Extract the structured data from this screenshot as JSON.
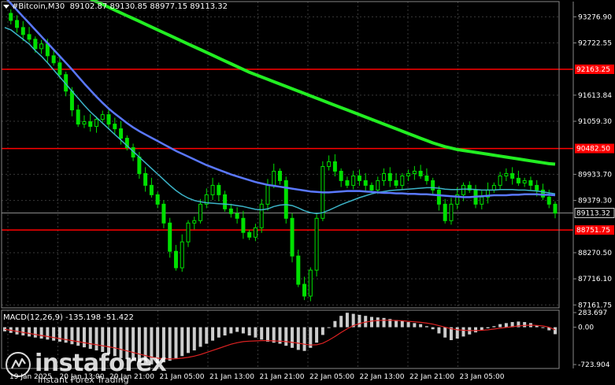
{
  "header": {
    "symbol": "#Bitcoin,M30",
    "ohlc": "89102.87 89130.85 88977.15 89113.32"
  },
  "macd": {
    "label": "MACD(12,26,9) -135.198 -51.422"
  },
  "watermark": {
    "brand": "instaforex",
    "tagline": "Instant Forex Trading"
  },
  "colors": {
    "bg": "#000000",
    "candle": "#00e000",
    "grid": "#3a3a3a",
    "level": "#ff0000",
    "ma_fast": "#3cb4c8",
    "ma_mid": "#5a78ff",
    "ma_slow": "#22ee22",
    "signal": "#dd2222",
    "hist": "#cccccc"
  },
  "chart_data": {
    "type": "candlestick",
    "symbol": "#Bitcoin",
    "timeframe": "M30",
    "price_axis": {
      "ticks": [
        93276.9,
        92722.55,
        91613.84,
        91059.3,
        89933.7,
        89379.3,
        88270.5,
        87716.1,
        87161.75
      ],
      "range": [
        87100,
        93600
      ]
    },
    "time_axis": {
      "ticks": [
        "19 Jan 2025",
        "20 Jan 13:00",
        "20 Jan 21:00",
        "21 Jan 05:00",
        "21 Jan 13:00",
        "21 Jan 21:00",
        "22 Jan 05:00",
        "22 Jan 13:00",
        "22 Jan 21:00",
        "23 Jan 05:00"
      ]
    },
    "levels": [
      {
        "price": 92163.25,
        "label": "92163.25",
        "color": "#ff0000"
      },
      {
        "price": 90482.5,
        "label": "90482.50",
        "color": "#ff0000"
      },
      {
        "price": 88751.75,
        "label": "88751.75",
        "color": "#ff0000"
      }
    ],
    "current_price": {
      "price": 89113.32,
      "label": "89113.32"
    },
    "close_series": [
      93350,
      93200,
      93050,
      92900,
      92800,
      92600,
      92700,
      92450,
      92300,
      92050,
      91700,
      91300,
      91000,
      91050,
      90950,
      91100,
      91200,
      91000,
      90900,
      90700,
      90500,
      90300,
      89950,
      89700,
      89500,
      89300,
      88900,
      88300,
      87950,
      88500,
      88900,
      88950,
      89300,
      89500,
      89700,
      89500,
      89200,
      89100,
      89000,
      88700,
      88600,
      88800,
      89300,
      89700,
      90000,
      89800,
      89000,
      88200,
      87600,
      87350,
      87900,
      89000,
      90100,
      90200,
      90000,
      89800,
      89700,
      89900,
      89800,
      89700,
      89600,
      89800,
      89950,
      89800,
      89700,
      89900,
      89950,
      90000,
      89900,
      89800,
      89600,
      89300,
      88950,
      89300,
      89500,
      89700,
      89600,
      89300,
      89450,
      89600,
      89700,
      89900,
      89950,
      89850,
      89750,
      89800,
      89700,
      89600,
      89450,
      89300,
      89110
    ],
    "moving_averages": [
      {
        "name": "MA fast",
        "color": "#3cb4c8",
        "values": [
          93050,
          93000,
          92900,
          92800,
          92700,
          92560,
          92440,
          92300,
          92150,
          92000,
          91850,
          91700,
          91550,
          91400,
          91260,
          91140,
          91020,
          90900,
          90780,
          90660,
          90540,
          90420,
          90300,
          90180,
          90060,
          89940,
          89820,
          89700,
          89590,
          89500,
          89430,
          89380,
          89350,
          89330,
          89320,
          89310,
          89300,
          89290,
          89270,
          89250,
          89220,
          89190,
          89180,
          89200,
          89250,
          89280,
          89290,
          89270,
          89220,
          89160,
          89120,
          89100,
          89120,
          89170,
          89230,
          89290,
          89340,
          89390,
          89440,
          89480,
          89520,
          89550,
          89570,
          89590,
          89600,
          89610,
          89620,
          89630,
          89640,
          89650,
          89650,
          89640,
          89620,
          89610,
          89610,
          89620,
          89620,
          89610,
          89600,
          89600,
          89600,
          89610,
          89610,
          89610,
          89600,
          89600,
          89590,
          89580,
          89560,
          89540,
          89520
        ]
      },
      {
        "name": "MA mid",
        "color": "#5a78ff",
        "values": [
          93700,
          93560,
          93420,
          93280,
          93140,
          93000,
          92860,
          92720,
          92580,
          92440,
          92300,
          92160,
          92010,
          91860,
          91720,
          91580,
          91450,
          91330,
          91220,
          91120,
          91020,
          90930,
          90850,
          90780,
          90710,
          90640,
          90570,
          90500,
          90430,
          90370,
          90310,
          90250,
          90190,
          90130,
          90080,
          90030,
          89980,
          89930,
          89890,
          89850,
          89810,
          89770,
          89740,
          89710,
          89690,
          89670,
          89650,
          89630,
          89610,
          89590,
          89570,
          89560,
          89550,
          89550,
          89560,
          89570,
          89580,
          89580,
          89580,
          89570,
          89560,
          89550,
          89540,
          89540,
          89530,
          89530,
          89520,
          89520,
          89510,
          89510,
          89500,
          89490,
          89480,
          89470,
          89460,
          89450,
          89450,
          89460,
          89470,
          89480,
          89490,
          89490,
          89490,
          89500,
          89500,
          89510,
          89510,
          89510,
          89500,
          89500,
          89490
        ]
      },
      {
        "name": "MA slow",
        "color": "#22ee22",
        "values": [
          94500,
          94440,
          94380,
          94320,
          94260,
          94200,
          94140,
          94080,
          94020,
          93960,
          93900,
          93840,
          93780,
          93720,
          93660,
          93600,
          93540,
          93480,
          93420,
          93360,
          93300,
          93240,
          93180,
          93120,
          93060,
          93000,
          92940,
          92880,
          92820,
          92760,
          92700,
          92640,
          92580,
          92520,
          92460,
          92400,
          92340,
          92280,
          92220,
          92160,
          92100,
          92050,
          92000,
          91950,
          91900,
          91850,
          91800,
          91750,
          91700,
          91650,
          91600,
          91550,
          91500,
          91450,
          91400,
          91350,
          91300,
          91250,
          91200,
          91150,
          91100,
          91050,
          91000,
          90950,
          90900,
          90850,
          90800,
          90750,
          90700,
          90650,
          90600,
          90560,
          90520,
          90490,
          90460,
          90440,
          90420,
          90400,
          90380,
          90360,
          90340,
          90320,
          90300,
          90280,
          90260,
          90240,
          90220,
          90200,
          90180,
          90160,
          90150
        ]
      }
    ],
    "macd": {
      "params": "MACD(12,26,9)",
      "main": -135.198,
      "signal": -51.422,
      "axis_ticks": [
        283.697,
        0.0,
        -723.904
      ],
      "range": [
        -800,
        330
      ],
      "histogram": [
        -80,
        -110,
        -140,
        -160,
        -180,
        -200,
        -220,
        -240,
        -260,
        -280,
        -300,
        -330,
        -360,
        -390,
        -420,
        -450,
        -480,
        -520,
        -560,
        -600,
        -620,
        -650,
        -680,
        -700,
        -720,
        -700,
        -680,
        -650,
        -600,
        -560,
        -500,
        -450,
        -380,
        -320,
        -260,
        -200,
        -160,
        -120,
        -90,
        -120,
        -160,
        -200,
        -240,
        -280,
        -300,
        -320,
        -360,
        -400,
        -440,
        -460,
        -400,
        -300,
        -150,
        0,
        120,
        220,
        280,
        260,
        240,
        220,
        200,
        190,
        180,
        160,
        140,
        120,
        100,
        80,
        60,
        20,
        -40,
        -120,
        -200,
        -250,
        -220,
        -180,
        -140,
        -100,
        -60,
        -20,
        20,
        60,
        80,
        100,
        110,
        100,
        80,
        40,
        0,
        -60,
        -135
      ],
      "signal_series": [
        -40,
        -60,
        -80,
        -100,
        -120,
        -140,
        -160,
        -180,
        -200,
        -220,
        -240,
        -260,
        -280,
        -300,
        -320,
        -340,
        -360,
        -380,
        -400,
        -430,
        -460,
        -490,
        -520,
        -550,
        -580,
        -600,
        -610,
        -615,
        -610,
        -600,
        -585,
        -560,
        -530,
        -490,
        -450,
        -410,
        -370,
        -330,
        -300,
        -280,
        -270,
        -265,
        -260,
        -260,
        -265,
        -270,
        -280,
        -295,
        -310,
        -330,
        -345,
        -340,
        -310,
        -250,
        -180,
        -100,
        -30,
        30,
        70,
        100,
        120,
        130,
        135,
        135,
        130,
        125,
        115,
        105,
        95,
        80,
        60,
        30,
        0,
        -30,
        -50,
        -60,
        -65,
        -65,
        -60,
        -50,
        -35,
        -20,
        -5,
        10,
        25,
        35,
        40,
        35,
        25,
        0,
        -51
      ]
    }
  }
}
